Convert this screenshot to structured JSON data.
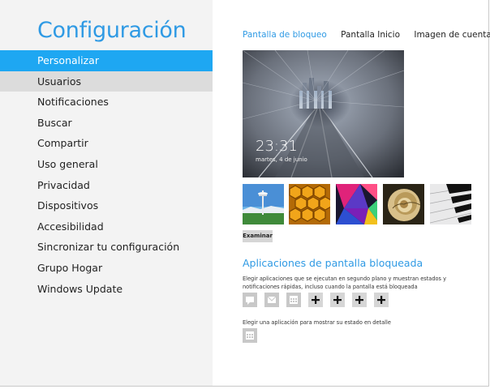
{
  "settings": {
    "title": "Configuración",
    "nav": [
      "Personalizar",
      "Usuarios",
      "Notificaciones",
      "Buscar",
      "Compartir",
      "Uso general",
      "Privacidad",
      "Dispositivos",
      "Accesibilidad",
      "Sincronizar tu configuración",
      "Grupo Hogar",
      "Windows Update"
    ],
    "active_index": 0,
    "hover_index": 1
  },
  "tabs": [
    "Pantalla de bloqueo",
    "Pantalla Inicio",
    "Imagen de cuenta"
  ],
  "lock_preview": {
    "time": "23:31",
    "date": "martes, 4 de junio"
  },
  "thumbnails": [
    "space-needle-image",
    "honeycomb-image",
    "colorful-triangles-image",
    "nautilus-shell-image",
    "piano-keys-image"
  ],
  "browse_button": "Examinar",
  "lock_apps": {
    "title": "Aplicaciones de pantalla bloqueada",
    "description": "Elegir aplicaciones que se ejecutan en segundo plano y muestran estados y notificaciones rápidas, incluso cuando la pantalla está bloqueada",
    "slots": [
      "messaging-icon",
      "mail-icon",
      "calendar-icon",
      "plus-icon",
      "plus-icon",
      "plus-icon",
      "plus-icon"
    ],
    "detail_description": "Elegir una aplicación para mostrar su estado en detalle",
    "detail_slot": "calendar-icon"
  },
  "colors": {
    "accent": "#2f9ae4",
    "selected": "#1ea7f2",
    "sidebar": "#f3f3f3"
  }
}
